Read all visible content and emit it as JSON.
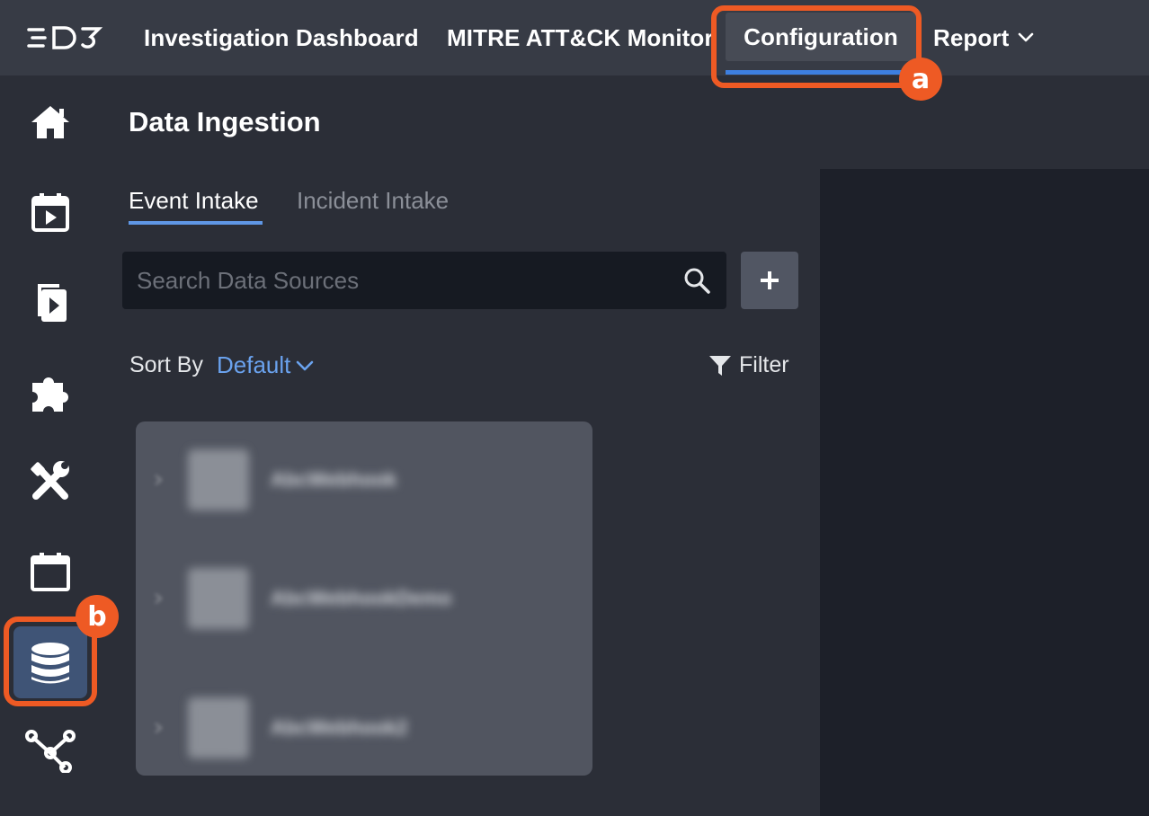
{
  "app": {
    "logo_text": "D3"
  },
  "topnav": {
    "items": [
      {
        "label": "Investigation Dashboard"
      },
      {
        "label": "MITRE ATT&CK Monitor"
      },
      {
        "label": "Configuration",
        "active": true
      },
      {
        "label": "Report",
        "has_dropdown": true
      }
    ]
  },
  "annotations": {
    "a": "a",
    "b": "b"
  },
  "sidebar": {
    "items": [
      {
        "icon": "home-icon"
      },
      {
        "icon": "calendar-play-icon"
      },
      {
        "icon": "document-play-icon"
      },
      {
        "icon": "puzzle-icon"
      },
      {
        "icon": "tools-icon"
      },
      {
        "icon": "calendar-icon"
      },
      {
        "icon": "database-icon",
        "active": true
      },
      {
        "icon": "share-nodes-icon"
      }
    ]
  },
  "page": {
    "title": "Data Ingestion"
  },
  "tabs": [
    {
      "label": "Event Intake",
      "active": true
    },
    {
      "label": "Incident Intake"
    }
  ],
  "search": {
    "placeholder": "Search Data Sources",
    "value": ""
  },
  "add_button": {
    "label": "+"
  },
  "sort": {
    "label": "Sort By",
    "value": "Default"
  },
  "filter": {
    "label": "Filter"
  },
  "data_sources": [
    {
      "name": "AbcWebhook"
    },
    {
      "name": "AbcWebhookDemo"
    },
    {
      "name": "AbcWebhook2"
    }
  ],
  "colors": {
    "accent": "#3d7fe0",
    "highlight": "#ee5a24",
    "link": "#6aa2ee",
    "sidebar_active": "#3f5476"
  }
}
